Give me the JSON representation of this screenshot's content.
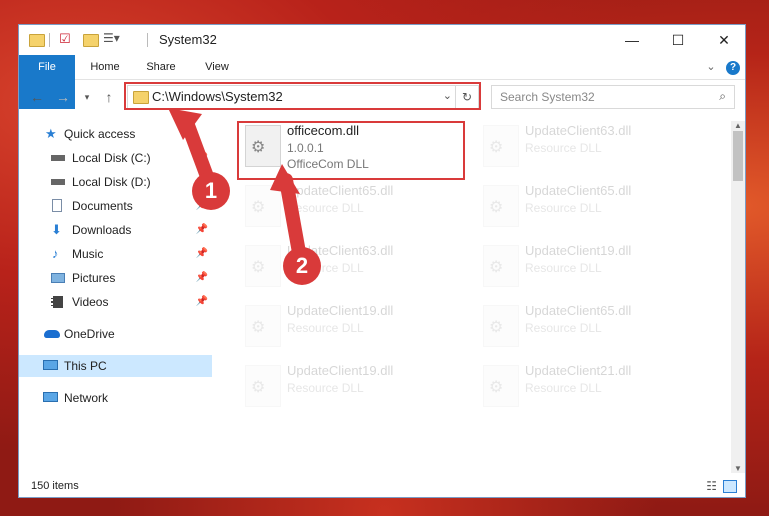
{
  "window": {
    "title": "System32"
  },
  "ribbon": {
    "tabs": [
      "File",
      "Home",
      "Share",
      "View"
    ]
  },
  "address": {
    "path": "C:\\Windows\\System32"
  },
  "search": {
    "placeholder": "Search System32"
  },
  "nav": {
    "items": [
      {
        "label": "Quick access",
        "icon": "star-icon"
      },
      {
        "label": "Local Disk (C:)",
        "icon": "drive-icon"
      },
      {
        "label": "Local Disk (D:)",
        "icon": "drive-icon"
      },
      {
        "label": "Documents",
        "icon": "documents-icon"
      },
      {
        "label": "Downloads",
        "icon": "download-icon"
      },
      {
        "label": "Music",
        "icon": "music-icon"
      },
      {
        "label": "Pictures",
        "icon": "pictures-icon"
      },
      {
        "label": "Videos",
        "icon": "videos-icon"
      },
      {
        "label": "OneDrive",
        "icon": "cloud-icon"
      },
      {
        "label": "This PC",
        "icon": "computer-icon"
      },
      {
        "label": "Network",
        "icon": "network-icon"
      }
    ]
  },
  "files": {
    "highlighted": {
      "name": "officecom.dll",
      "version": "1.0.0.1",
      "description": "OfficeCom DLL"
    },
    "faded": [
      {
        "name": "UpdateClient63.dll",
        "description": "Resource DLL"
      },
      {
        "name": "UpdateClient65.dll",
        "description": "Resource DLL"
      },
      {
        "name": "UpdateClient65.dll",
        "description": "Resource DLL"
      },
      {
        "name": "UpdateClient63.dll",
        "description": "Resource DLL"
      },
      {
        "name": "UpdateClient19.dll",
        "description": "Resource DLL"
      },
      {
        "name": "UpdateClient19.dll",
        "description": "Resource DLL"
      },
      {
        "name": "UpdateClient65.dll",
        "description": "Resource DLL"
      },
      {
        "name": "UpdateClient19.dll",
        "description": "Resource DLL"
      },
      {
        "name": "UpdateClient21.dll",
        "description": "Resource DLL"
      }
    ]
  },
  "status": {
    "items_count": "150 items"
  },
  "callouts": {
    "one": "1",
    "two": "2"
  },
  "colors": {
    "accent": "#1979ca",
    "callout": "#d93a3a"
  }
}
